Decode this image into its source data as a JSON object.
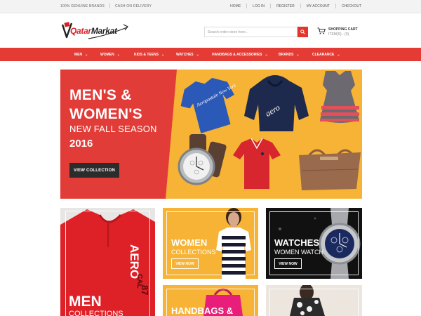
{
  "topbar": {
    "left": [
      "100% GENUINE BRANDS",
      "CASH ON DELIVERY"
    ],
    "links": [
      "HOME",
      "LOG IN",
      "REGISTER",
      "MY ACCOUNT",
      "CHECKOUT"
    ]
  },
  "header": {
    "logo_text_1": "Qatar",
    "logo_text_2": "Markat",
    "search_placeholder": "Search entire store here...",
    "cart_title": "SHOPPING CART",
    "cart_items": "ITEM(S) - (0)"
  },
  "nav": {
    "items": [
      "MEN",
      "WOMEN",
      "KIDS & TEENS",
      "WATCHES",
      "HANDBAGS & ACCESSORIES",
      "BRANDS",
      "CLEARANCE"
    ]
  },
  "hero": {
    "line1": "MEN'S &",
    "line2": "WOMEN'S",
    "line3": "NEW FALL SEASON",
    "line4": "2016",
    "cta": "VIEW COLLECTION",
    "tshirt_text": "Aeropostale New York"
  },
  "tiles": {
    "men": {
      "title": "MEN",
      "sub": "COLLECTIONS",
      "shirt_text": "AERO",
      "shirt_num": "87"
    },
    "women": {
      "title": "WOMEN",
      "sub": "COLLECTIONS",
      "button": "VIEW NOW"
    },
    "watches": {
      "title": "WATCHES",
      "sub": "WOMEN WATCH",
      "button": "VIEW NOW"
    },
    "bags": {
      "title": "HANDBAGS &"
    }
  },
  "colors": {
    "brand_red": "#e43c35",
    "accent_yellow": "#f6b335",
    "dark": "#2c2c2c"
  }
}
